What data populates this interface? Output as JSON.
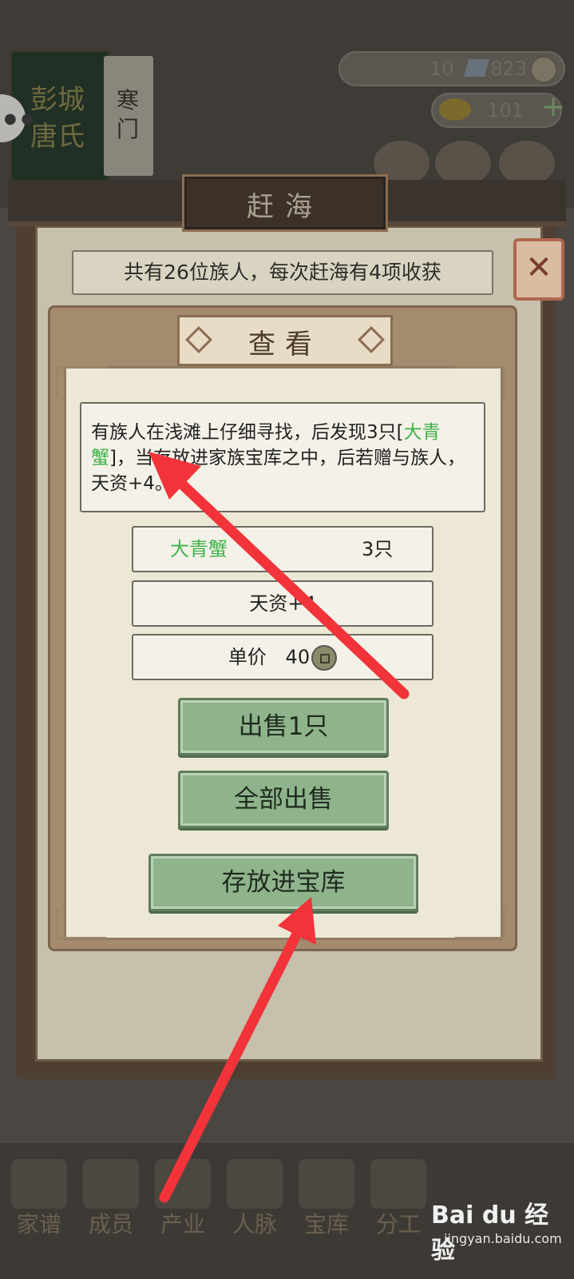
{
  "top": {
    "book_title": "彭城 唐氏",
    "book_sub": "寒门",
    "resource1": "10",
    "resource1b": "823",
    "resource2": "101",
    "icons": [
      "chat-icon",
      "gem-icon",
      "coin-icon",
      "gold-icon",
      "plus-icon"
    ]
  },
  "panel": {
    "title": "赶海",
    "info": "共有26位族人，每次赶海有4项收获",
    "close_icon": "close-icon"
  },
  "dialog": {
    "title": "查看",
    "desc_part1": "有族人在浅滩上仔细寻找，后发现3只[",
    "desc_item": "大青蟹",
    "desc_part2": "]，当存放进家族宝库之中，后若赠与族人，天资+4。",
    "item_name": "大青蟹",
    "item_count": "3只",
    "attr": "天资+4",
    "price_label": "单价",
    "price_value": "40",
    "btn_sell_one": "出售1只",
    "btn_sell_all": "全部出售",
    "btn_store": "存放进宝库"
  },
  "nav": [
    "家谱",
    "成员",
    "产业",
    "人脉",
    "宝库",
    "分工"
  ],
  "watermark": {
    "logo": "Bai du 经验",
    "url": "jingyan.baidu.com"
  },
  "colors": {
    "accent_green": "#3fb24b",
    "button_green": "#8fb48c",
    "arrow_red": "#f2333a"
  }
}
